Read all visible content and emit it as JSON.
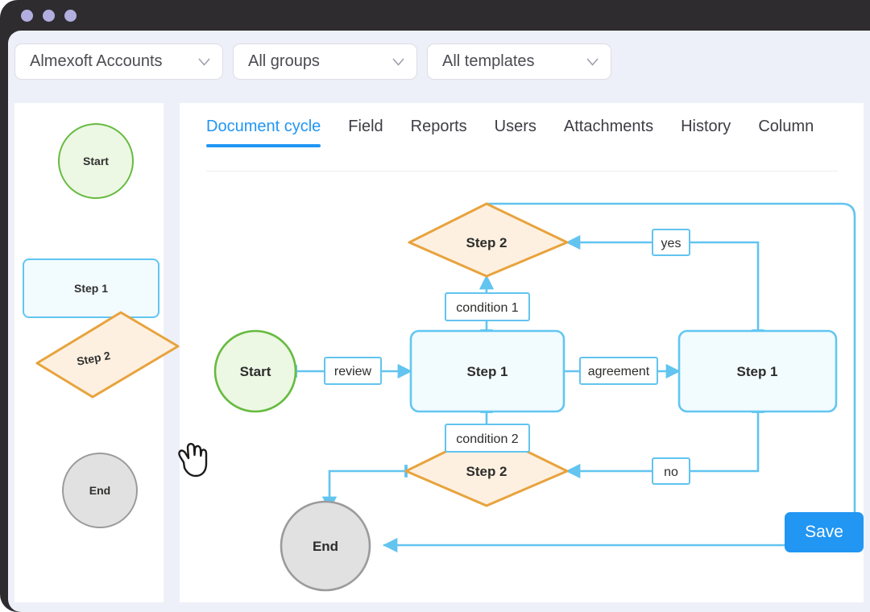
{
  "window": {
    "traffic_lights": [
      "close",
      "minimize",
      "maximize"
    ]
  },
  "filters": [
    {
      "name": "account-select",
      "value": "Almexoft Accounts",
      "icon": "chevron-down-icon"
    },
    {
      "name": "group-select",
      "value": "All groups",
      "icon": "chevron-down-icon"
    },
    {
      "name": "template-select",
      "value": "All templates",
      "icon": "chevron-down-icon"
    }
  ],
  "sidebar": {
    "palette": [
      {
        "label": "Start",
        "shape": "circle",
        "state": "idle"
      },
      {
        "label": "Step 1",
        "shape": "rounded-rect",
        "state": "idle"
      },
      {
        "label": "Step 2",
        "shape": "parallelogram",
        "state": "dragging"
      },
      {
        "label": "End",
        "shape": "circle",
        "state": "idle"
      }
    ],
    "cursor": "drag-hand-cursor"
  },
  "tabs": [
    {
      "label": "Document cycle",
      "active": true
    },
    {
      "label": "Field",
      "active": false
    },
    {
      "label": "Reports",
      "active": false
    },
    {
      "label": "Users",
      "active": false
    },
    {
      "label": "Attachments",
      "active": false
    },
    {
      "label": "History",
      "active": false
    },
    {
      "label": "Column",
      "active": false
    }
  ],
  "footer": {
    "save_label": "Save"
  },
  "diagram": {
    "nodes": {
      "start": "Start",
      "step1_center": "Step 1",
      "step1_right": "Step 1",
      "step2_top": "Step 2",
      "step2_bottom": "Step 2",
      "end": "End"
    },
    "edge_labels": {
      "review": "review",
      "agreement": "agreement",
      "condition1": "condition 1",
      "condition2": "condition 2",
      "yes": "yes",
      "no": "no"
    }
  },
  "colors": {
    "accent": "#2196f3",
    "edge": "#62c4ef",
    "start_border": "#66bb3f",
    "start_fill": "#ecf7e4",
    "step_border": "#61c6f2",
    "step_fill": "#f2fbfe",
    "decision_border": "#e8a33d",
    "decision_fill": "#fdf0e0",
    "end_border": "#9b9b9e",
    "end_fill": "#e1e1e1",
    "titlebar": "#2e2c2f",
    "dot": "#b2aee0",
    "app_bg": "#eef0f9"
  }
}
